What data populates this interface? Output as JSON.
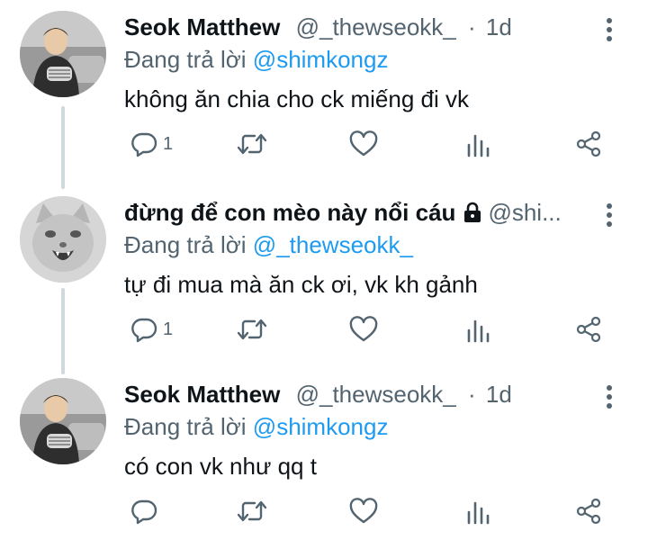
{
  "replying_prefix": "Đang trả lời",
  "replies": [
    {
      "name": "Seok Matthew",
      "handle": "@_thewseokk_",
      "separator": "·",
      "time": "1d",
      "replying_to": "@shimkongz",
      "text": "không ăn chia cho ck miếng đi vk",
      "reply_count": "1",
      "avatar_icon": "person-on-couch-avatar"
    },
    {
      "name": "đừng để con mèo này nổi cáu",
      "handle": "@shi...",
      "separator": "",
      "time": "",
      "protected_icon": "lock-icon",
      "replying_to": "@_thewseokk_",
      "text": "tự đi mua mà ăn ck ơi, vk kh gảnh",
      "reply_count": "1",
      "avatar_icon": "cat-avatar"
    },
    {
      "name": "Seok Matthew",
      "handle": "@_thewseokk_",
      "separator": "·",
      "time": "1d",
      "replying_to": "@shimkongz",
      "text": "có con vk như qq t",
      "reply_count": "",
      "avatar_icon": "person-on-couch-avatar"
    }
  ],
  "colors": {
    "text": "#0f1419",
    "secondary": "#536471",
    "accent": "#1d9bf0",
    "thread_line": "#cfd9de"
  }
}
